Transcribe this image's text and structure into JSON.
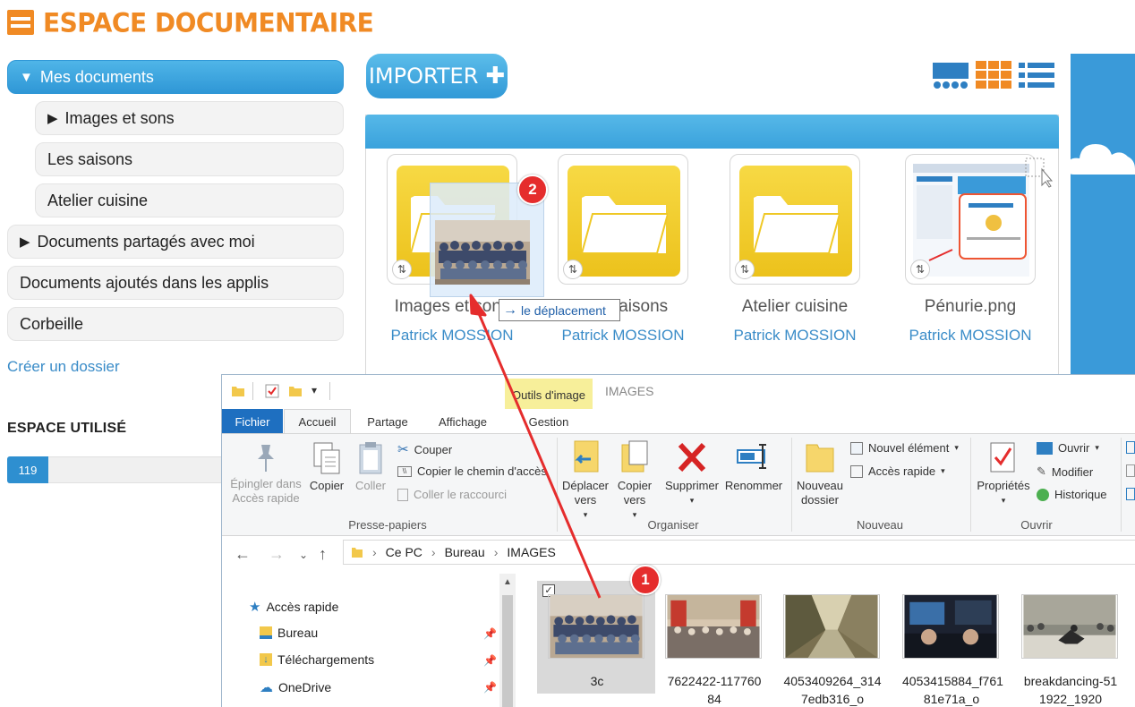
{
  "header": {
    "title": "ESPACE DOCUMENTAIRE"
  },
  "sidebar": {
    "items": [
      {
        "label": "Mes documents",
        "expanded": true
      },
      {
        "label": "Images et sons",
        "expanded": false
      },
      {
        "label": "Les saisons"
      },
      {
        "label": "Atelier cuisine"
      },
      {
        "label": "Documents partagés avec moi",
        "expanded": false
      },
      {
        "label": "Documents ajoutés dans les applis"
      },
      {
        "label": "Corbeille"
      }
    ],
    "create_folder": "Créer un dossier",
    "space_title": "ESPACE UTILISÉ",
    "space_used": "119"
  },
  "toolbar": {
    "import_label": "IMPORTER"
  },
  "documents": [
    {
      "name": "Images et sons",
      "owner": "Patrick MOSSION",
      "type": "folder"
    },
    {
      "name": "Les saisons",
      "owner": "Patrick MOSSION",
      "type": "folder"
    },
    {
      "name": "Atelier cuisine",
      "owner": "Patrick MOSSION",
      "type": "folder"
    },
    {
      "name": "Pénurie.png",
      "owner": "Patrick MOSSION",
      "type": "image"
    }
  ],
  "drag": {
    "tooltip": "le déplacement",
    "step1": "1",
    "step2": "2"
  },
  "explorer": {
    "contextual_tab": "Outils d'image",
    "window_title": "IMAGES",
    "tabs": [
      "Fichier",
      "Accueil",
      "Partage",
      "Affichage",
      "Gestion"
    ],
    "ribbon": {
      "pin_label": "Épingler dans Accès rapide",
      "copy_label": "Copier",
      "paste_label": "Coller",
      "cut_label": "Couper",
      "copy_path_label": "Copier le chemin d'accès",
      "paste_shortcut_label": "Coller le raccourci",
      "group_clipboard": "Presse-papiers",
      "move_to_label": "Déplacer vers",
      "copy_to_label": "Copier vers",
      "delete_label": "Supprimer",
      "rename_label": "Renommer",
      "group_organize": "Organiser",
      "new_folder_label": "Nouveau dossier",
      "new_item_label": "Nouvel élément",
      "quick_access_label": "Accès rapide",
      "group_new": "Nouveau",
      "properties_label": "Propriétés",
      "open_label": "Ouvrir",
      "edit_label": "Modifier",
      "history_label": "Historique",
      "group_open": "Ouvrir"
    },
    "breadcrumb": [
      "Ce PC",
      "Bureau",
      "IMAGES"
    ],
    "nav": [
      {
        "label": "Accès rapide"
      },
      {
        "label": "Bureau"
      },
      {
        "label": "Téléchargements"
      },
      {
        "label": "OneDrive"
      }
    ],
    "files": [
      {
        "label": "3c"
      },
      {
        "label": "7622422-117760 84"
      },
      {
        "label": "4053409264_314 7edb316_o"
      },
      {
        "label": "4053415884_f761 81e71a_o"
      },
      {
        "label": "breakdancing-51 1922_1920"
      }
    ]
  },
  "colors": {
    "accent_orange": "#f08a24",
    "accent_blue": "#3199d7",
    "badge_red": "#e52d2d",
    "arrow_red": "#e52d2d"
  }
}
